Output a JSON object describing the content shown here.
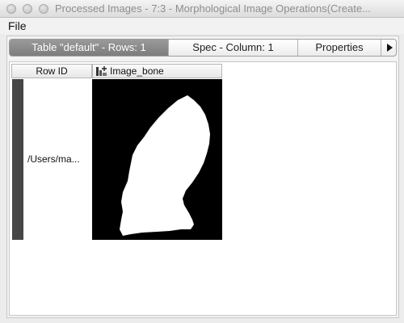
{
  "window": {
    "title": "Processed Images - 7:3 - Morphological Image Operations(Create..."
  },
  "menu": {
    "file_label": "File"
  },
  "tabs": [
    {
      "label": "Table \"default\" - Rows: 1",
      "active": true
    },
    {
      "label": "Spec - Column: 1",
      "active": false
    },
    {
      "label": "Properties",
      "active": false
    }
  ],
  "tab_scroll_icon": "triangle-right-icon",
  "table": {
    "columns": [
      {
        "label": "Row ID"
      },
      {
        "label": "Image_bone",
        "icon": "image-column-icon"
      }
    ],
    "rows": [
      {
        "row_id": "/Users/ma...",
        "image": "binary-bone-mask"
      }
    ]
  },
  "colors": {
    "active_tab": "#8a8a8a",
    "row_marker": "#464646",
    "image_background": "#000000",
    "image_foreground": "#ffffff"
  }
}
